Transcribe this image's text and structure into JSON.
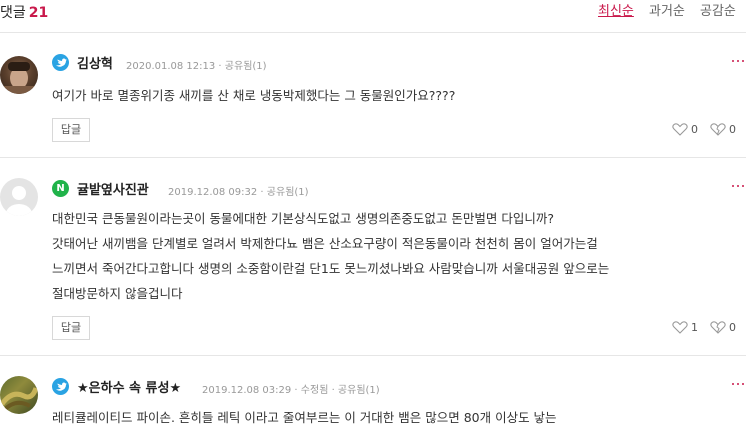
{
  "header": {
    "label": "댓글",
    "count": "21",
    "sorts": {
      "latest": "최신순",
      "oldest": "과거순",
      "popular": "공감순"
    }
  },
  "comments": [
    {
      "author": "김상혁",
      "meta": "2020.01.08 12:13 · 공유됨(1)",
      "body": [
        "여기가 바로 멸종위기종 새끼를 산 채로 냉동박제했다는 그 동물원인가요????"
      ],
      "reply_label": "답글",
      "likes": "0",
      "dislikes": "0",
      "badge": "twitter"
    },
    {
      "author": "귤밭옆사진관",
      "meta": "2019.12.08 09:32 · 공유됨(1)",
      "body": [
        "대한민국 큰동물원이라는곳이 동물에대한 기본상식도없고 생명의존중도없고 돈만벌면 다입니까?",
        "갓태어난 새끼뱀을 단계별로 얼려서 박제한다뇨 뱀은 산소요구량이 적은동물이라 천천히 몸이 얼어가는걸",
        "느끼면서 죽어간다고합니다 생명의 소중함이란걸 단1도 못느끼셨나봐요 사람맞습니까 서울대공원 앞으로는",
        "절대방문하지 않을겁니다"
      ],
      "reply_label": "답글",
      "likes": "1",
      "dislikes": "0",
      "badge": "naver",
      "badge_glyph": "N"
    },
    {
      "author": "★은하수 속 류성★",
      "meta": "2019.12.08 03:29 · 수정됨 · 공유됨(1)",
      "body": [
        "레티큘레이티드 파이손. 흔히들 레틱 이라고 줄여부르는 이 거대한 뱀은 많으면 80개 이상도 낳는"
      ],
      "badge": "twitter"
    }
  ]
}
